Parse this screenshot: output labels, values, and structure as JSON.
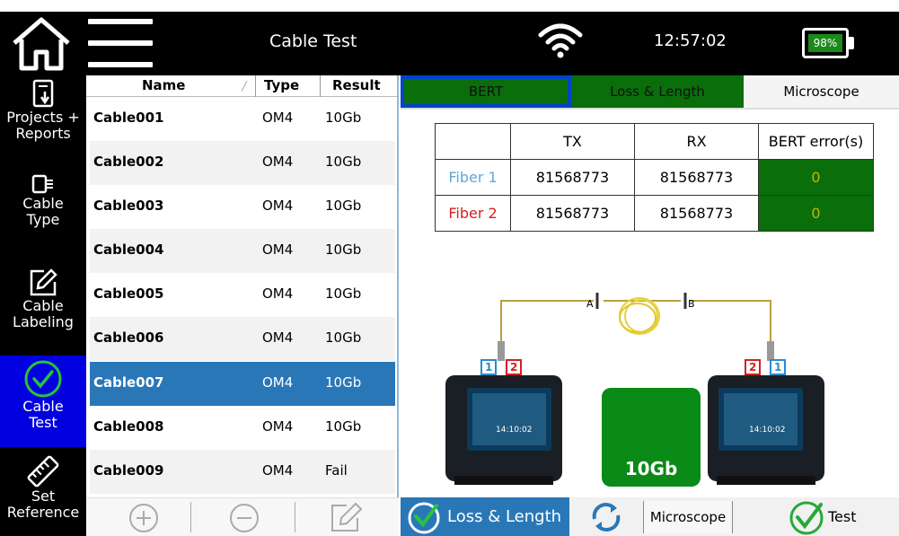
{
  "header": {
    "title": "Cable Test",
    "time": "12:57:02",
    "battery": "98%"
  },
  "sidebar": {
    "items": [
      {
        "label1": "Projects +",
        "label2": "Reports",
        "icon": "phone-document-icon"
      },
      {
        "label1": "Cable",
        "label2": "Type",
        "icon": "connector-icon"
      },
      {
        "label1": "Cable",
        "label2": "Labeling",
        "icon": "edit-icon"
      },
      {
        "label1": "Cable",
        "label2": "Test",
        "icon": "check-circle-icon"
      },
      {
        "label1": "Set",
        "label2": "Reference",
        "icon": "ruler-icon"
      }
    ]
  },
  "list": {
    "headers": {
      "name": "Name",
      "type": "Type",
      "result": "Result"
    },
    "rows": [
      {
        "name": "Cable001",
        "type": "OM4",
        "result": "10Gb"
      },
      {
        "name": "Cable002",
        "type": "OM4",
        "result": "10Gb"
      },
      {
        "name": "Cable003",
        "type": "OM4",
        "result": "10Gb"
      },
      {
        "name": "Cable004",
        "type": "OM4",
        "result": "10Gb"
      },
      {
        "name": "Cable005",
        "type": "OM4",
        "result": "10Gb"
      },
      {
        "name": "Cable006",
        "type": "OM4",
        "result": "10Gb"
      },
      {
        "name": "Cable007",
        "type": "OM4",
        "result": "10Gb"
      },
      {
        "name": "Cable008",
        "type": "OM4",
        "result": "10Gb"
      },
      {
        "name": "Cable009",
        "type": "OM4",
        "result": "Fail"
      }
    ]
  },
  "tabs": {
    "bert": "BERT",
    "loss": "Loss & Length",
    "microscope": "Microscope"
  },
  "results": {
    "headers": {
      "tx": "TX",
      "rx": "RX",
      "err": "BERT error(s)"
    },
    "rows": [
      {
        "fiber": "Fiber 1",
        "tx": "81568773",
        "rx": "81568773",
        "err": "0"
      },
      {
        "fiber": "Fiber 2",
        "tx": "81568773",
        "rx": "81568773",
        "err": "0"
      }
    ]
  },
  "diagram": {
    "end_a": "A",
    "end_b": "B",
    "port1": "1",
    "port2": "2",
    "device_time": "14:10:02",
    "pass_label": "10Gb"
  },
  "bottom": {
    "loss_label": "Loss & Length",
    "microscope_label": "Microscope",
    "test_label": "Test"
  },
  "colors": {
    "accent_blue": "#2a77b8",
    "pass_green": "#0a8a16",
    "active_sidebar": "#0000e0",
    "fiber1": "#5fa7d8",
    "fiber2": "#d42020"
  }
}
